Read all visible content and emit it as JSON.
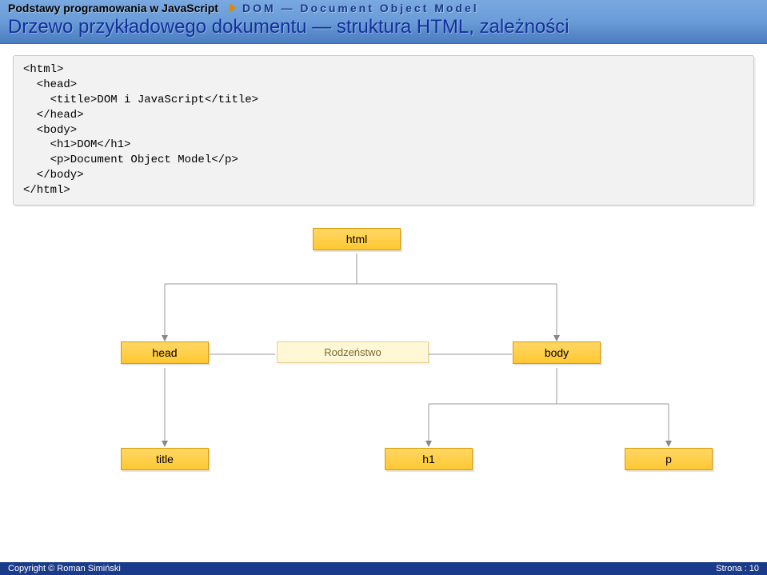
{
  "header": {
    "breadcrumb_left": "Podstawy programowania w JavaScript",
    "breadcrumb_right": "DOM — Document Object Model",
    "title": "Drzewo przykładowego dokumentu — struktura HTML, zależności"
  },
  "code": "<html>\n  <head>\n    <title>DOM i JavaScript</title>\n  </head>\n  <body>\n    <h1>DOM</h1>\n    <p>Document Object Model</p>\n  </body>\n</html>",
  "diagram": {
    "nodes": {
      "html": "html",
      "head": "head",
      "body": "body",
      "siblings": "Rodzeństwo",
      "title": "title",
      "h1": "h1",
      "p": "p"
    }
  },
  "footer": {
    "copyright": "Copyright © Roman Simiński",
    "page": "Strona : 10"
  }
}
